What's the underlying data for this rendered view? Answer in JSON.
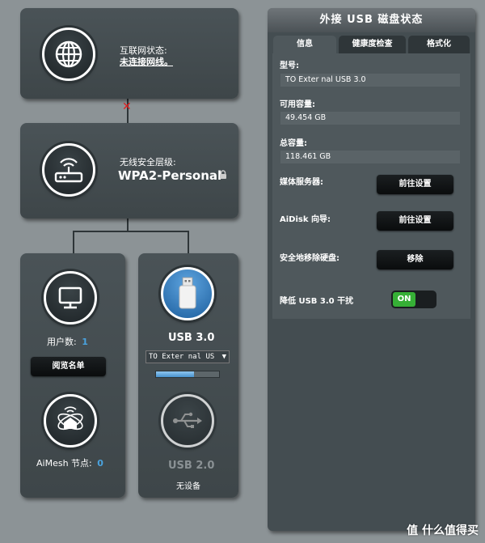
{
  "internet": {
    "status_label": "互联网状态:",
    "status_value": "未连接网线。"
  },
  "wireless": {
    "security_label": "无线安全层级:",
    "security_value": "WPA2-Personal"
  },
  "clients": {
    "count_label": "用户数:",
    "count_value": "1",
    "list_button": "阅览名单"
  },
  "aimesh": {
    "label": "AiMesh 节点:",
    "count_value": "0"
  },
  "usb30": {
    "label": "USB 3.0",
    "device_select": "TO Exter nal US",
    "usage_fraction": 0.6
  },
  "usb20": {
    "label": "USB 2.0",
    "status": "无设备"
  },
  "panel": {
    "title": "外接 USB 磁盘状态",
    "tabs": [
      {
        "label": "信息",
        "active": true
      },
      {
        "label": "健康度检查",
        "active": false
      },
      {
        "label": "格式化",
        "active": false
      }
    ],
    "model_label": "型号:",
    "model_value": "TO Exter nal USB 3.0",
    "available_label": "可用容量:",
    "available_value": "49.454 GB",
    "total_label": "总容量:",
    "total_value": "118.461 GB",
    "media_server_label": "媒体服务器:",
    "media_server_button": "前往设置",
    "aidisk_label": "AiDisk 向导:",
    "aidisk_button": "前往设置",
    "eject_label": "安全地移除硬盘:",
    "eject_button": "移除",
    "reduce_interference_label": "降低 USB 3.0 干扰",
    "reduce_interference_toggle": "ON"
  },
  "watermark": "值 什么值得买",
  "colors": {
    "accent_blue": "#4aa3df",
    "toggle_on": "#36b036",
    "disconnect_red": "#e02020"
  }
}
